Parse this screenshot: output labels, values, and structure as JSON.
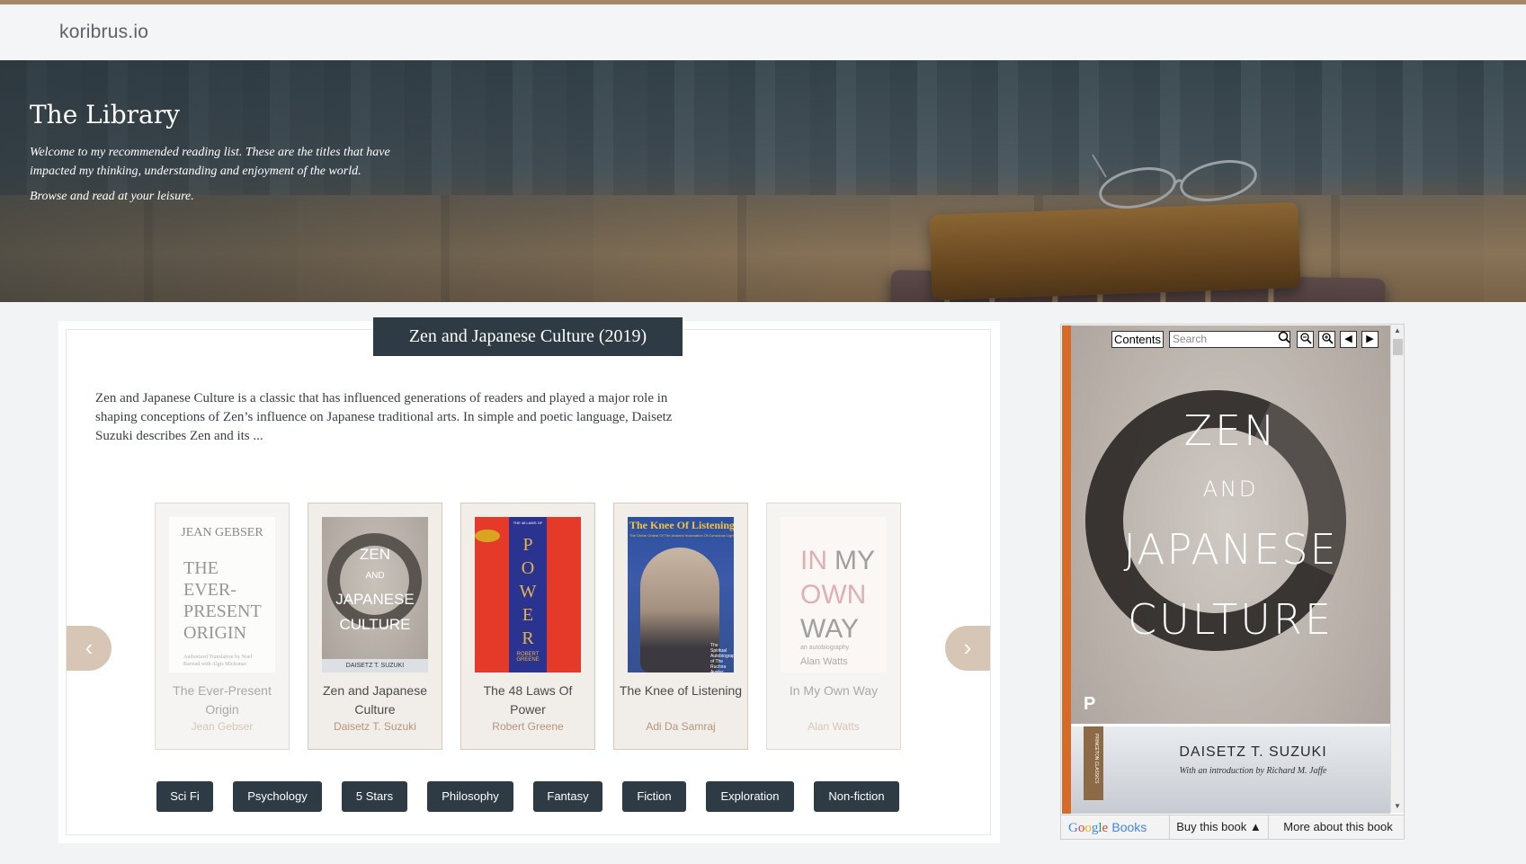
{
  "site": {
    "brand": "koribrus.io"
  },
  "hero": {
    "title": "The Library",
    "intro": "Welcome to my recommended reading list. These are the titles that have impacted my thinking, understanding and enjoyment of the world.",
    "browse": "Browse and read at your leisure."
  },
  "featured": {
    "title": "Zen and Japanese Culture (2019)",
    "description": "Zen and Japanese Culture is a classic that has influenced generations of readers and played a major role in shaping conceptions of Zen’s influence on Japanese traditional arts. In simple and poetic language, Daisetz Suzuki describes Zen and its ..."
  },
  "carousel": {
    "prev_icon": "chevron-left-icon",
    "next_icon": "chevron-right-icon",
    "books": [
      {
        "title": "The Ever-Present Origin",
        "author": "Jean Gebser",
        "cover_author": "JEAN GEBSER",
        "cover_title": "THE EVER-PRESENT ORIGIN",
        "cover_note": "Authorized Translation by Noel Barstad with Algis Mickunas",
        "faded": true
      },
      {
        "title": "Zen and Japanese Culture",
        "author": "Daisetz T. Suzuki",
        "cover_lines": [
          "ZEN",
          "AND",
          "JAPANESE",
          "CULTURE"
        ],
        "cover_author": "DAISETZ T. SUZUKI",
        "faded": false
      },
      {
        "title": "The 48 Laws Of Power",
        "author": "Robert Greene",
        "cover_word": "POWER",
        "cover_author": "ROBERT GREENE",
        "cover_top": "THE 48 LAWS OF",
        "faded": false
      },
      {
        "title": "The Knee of Listening",
        "author": "Adi Da Samraj",
        "cover_title": "The Knee Of Listening",
        "cover_sub": "The Divine Ordeal Of The Avataric Incarnation Of Conscious Light",
        "cover_side": "The Spiritual Autobiography of The Ruchira Avatar",
        "faded": false
      },
      {
        "title": "In My Own Way",
        "author": "Alan Watts",
        "cover_lines": [
          "IN",
          "MY",
          "OWN",
          "WAY"
        ],
        "cover_sub": "an autobiography",
        "cover_author": "Alan Watts",
        "faded": true
      }
    ]
  },
  "tags": [
    "Sci Fi",
    "Psychology",
    "5 Stars",
    "Philosophy",
    "Fantasy",
    "Fiction",
    "Exploration",
    "Non-fiction"
  ],
  "viewer": {
    "contents_label": "Contents",
    "search_placeholder": "Search",
    "cover_lines": [
      "ZEN",
      "AND",
      "JAPANESE",
      "CULTURE"
    ],
    "author": "DAISETZ T. SUZUKI",
    "intro_by": "With an introduction by Richard M. Jaffe",
    "spine_text": "PRINCETON CLASSICS",
    "footer": {
      "google": "Google",
      "books": "Books",
      "buy": "Buy this book ▲",
      "more": "More about this book"
    }
  },
  "colors": {
    "accent_bar": "#a8886a",
    "dark_button": "#2e3a44",
    "nav_button": "#d7c6b5",
    "author_text": "#b4967a",
    "google_blue": "#4285f4",
    "google_red": "#db4437",
    "google_yellow": "#f4b400",
    "google_green": "#0f9d58"
  }
}
